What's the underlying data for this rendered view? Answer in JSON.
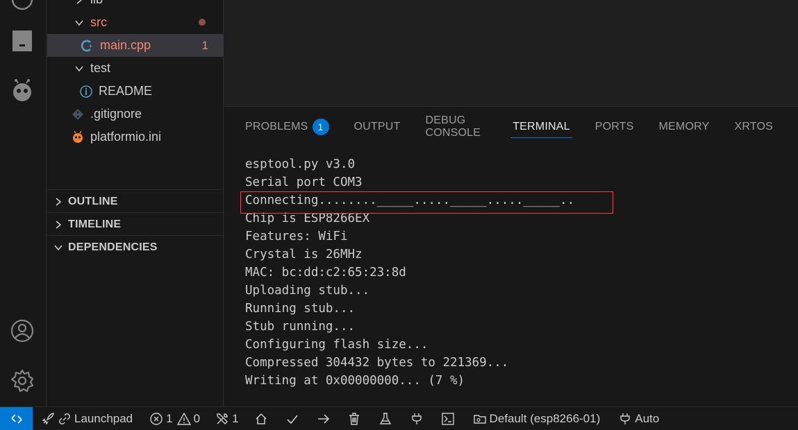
{
  "explorer": {
    "items": [
      {
        "label": "lib",
        "kind": "folder-collapsed"
      },
      {
        "label": "src",
        "kind": "folder-open"
      },
      {
        "label": "main.cpp",
        "kind": "file-cpp",
        "problems": "1"
      },
      {
        "label": "test",
        "kind": "folder-open"
      },
      {
        "label": "README",
        "kind": "file-info"
      },
      {
        "label": ".gitignore",
        "kind": "file-git"
      },
      {
        "label": "platformio.ini",
        "kind": "file-pio"
      }
    ],
    "sections": [
      "OUTLINE",
      "TIMELINE",
      "DEPENDENCIES"
    ]
  },
  "panel": {
    "tabs": [
      "PROBLEMS",
      "OUTPUT",
      "DEBUG CONSOLE",
      "TERMINAL",
      "PORTS",
      "MEMORY",
      "XRTOS"
    ],
    "problems_badge": "1",
    "active_tab": "TERMINAL"
  },
  "terminal": {
    "lines": [
      "esptool.py v3.0",
      "Serial port COM3",
      "Connecting........_____....._____....._____..",
      "Chip is ESP8266EX",
      "Features: WiFi",
      "Crystal is 26MHz",
      "MAC: bc:dd:c2:65:23:8d",
      "Uploading stub...",
      "Running stub...",
      "Stub running...",
      "Configuring flash size...",
      "Compressed 304432 bytes to 221369...",
      "Writing at 0x00000000... (7 %)"
    ]
  },
  "statusbar": {
    "launchpad": "Launchpad",
    "errors": "1",
    "warnings": "0",
    "tools_count": "1",
    "env": "Default (esp8266-01)",
    "port": "Auto"
  },
  "colors": {
    "accent": "#0078d4",
    "modified": "#f48771",
    "highlight": "#e04a4a"
  }
}
